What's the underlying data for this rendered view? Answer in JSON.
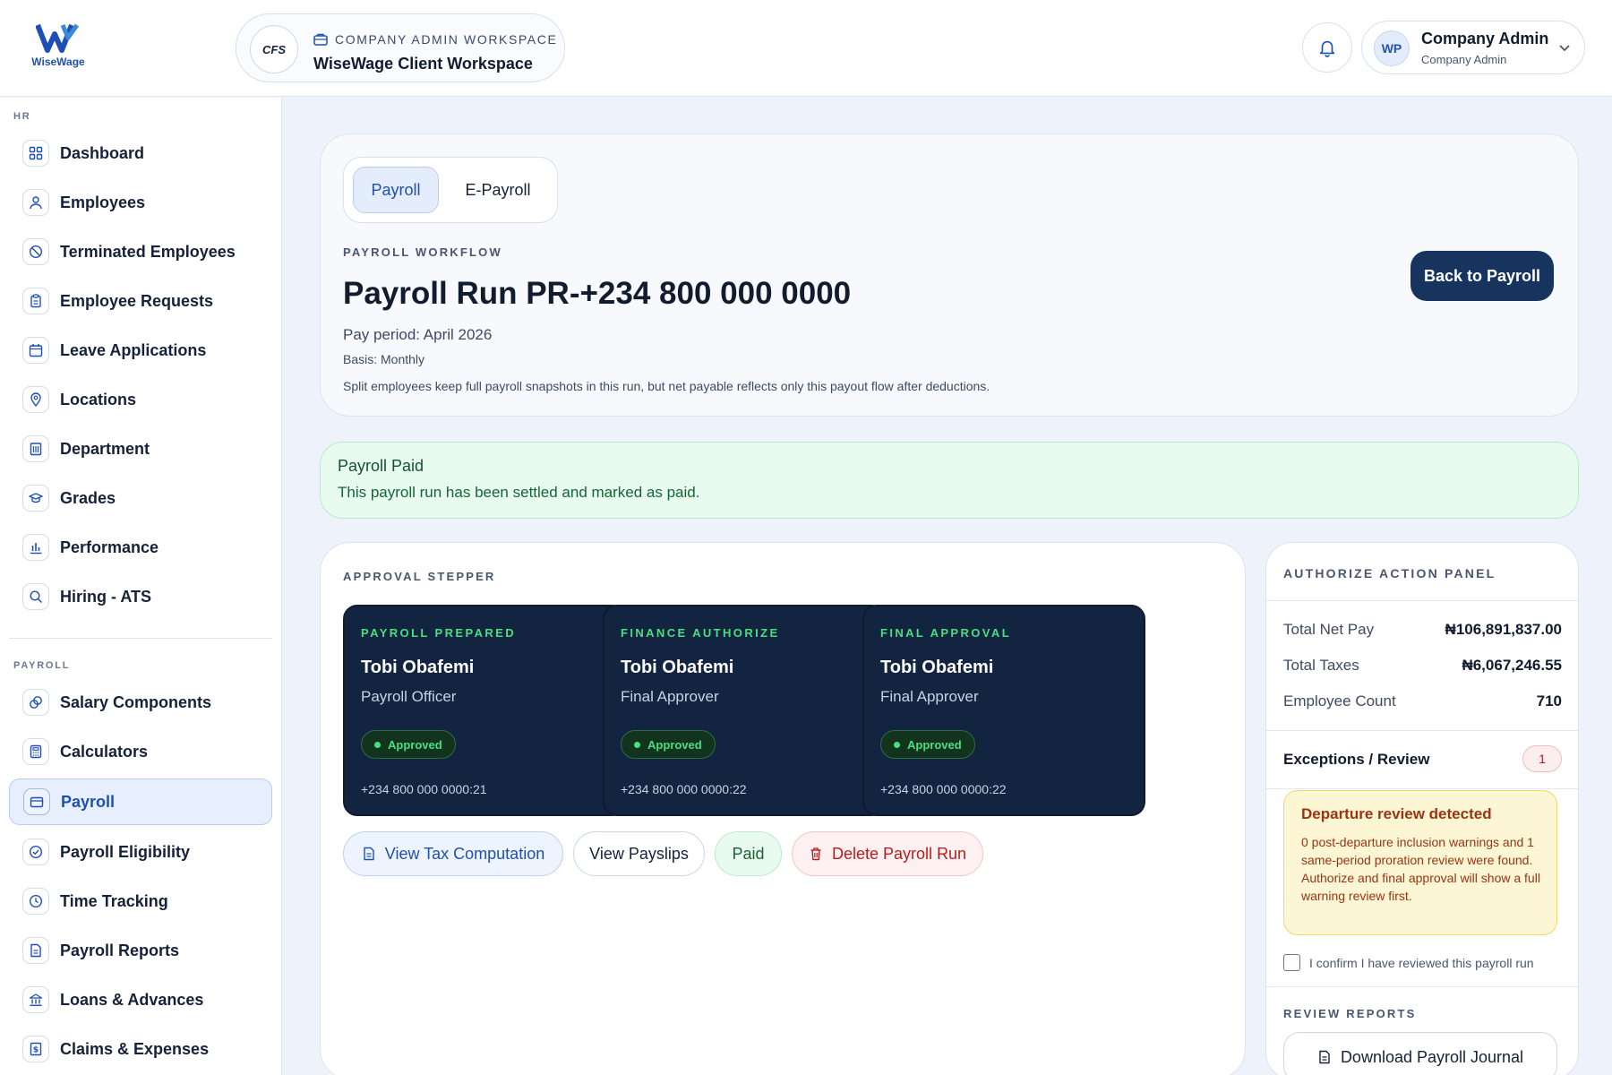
{
  "brand": {
    "name": "WiseWage"
  },
  "workspace": {
    "logo_text": "CFS",
    "eyebrow": "COMPANY ADMIN WORKSPACE",
    "name": "WiseWage Client Workspace"
  },
  "user": {
    "initials": "WP",
    "name": "Company Admin",
    "role": "Company Admin"
  },
  "sidebar": {
    "hr_label": "HR",
    "hr_items": [
      {
        "label": "Dashboard",
        "icon": "grid-icon"
      },
      {
        "label": "Employees",
        "icon": "user-icon"
      },
      {
        "label": "Terminated Employees",
        "icon": "user-off-icon"
      },
      {
        "label": "Employee Requests",
        "icon": "clipboard-icon"
      },
      {
        "label": "Leave Applications",
        "icon": "calendar-icon"
      },
      {
        "label": "Locations",
        "icon": "map-pin-icon"
      },
      {
        "label": "Department",
        "icon": "building-icon"
      },
      {
        "label": "Grades",
        "icon": "graduation-cap-icon"
      },
      {
        "label": "Performance",
        "icon": "bar-chart-icon"
      },
      {
        "label": "Hiring - ATS",
        "icon": "search-icon"
      }
    ],
    "payroll_label": "PAYROLL",
    "payroll_items": [
      {
        "label": "Salary Components",
        "icon": "coins-icon"
      },
      {
        "label": "Calculators",
        "icon": "calculator-icon"
      },
      {
        "label": "Payroll",
        "icon": "wallet-icon",
        "active": true
      },
      {
        "label": "Payroll Eligibility",
        "icon": "check-circle-icon"
      },
      {
        "label": "Time Tracking",
        "icon": "clock-icon"
      },
      {
        "label": "Payroll Reports",
        "icon": "file-text-icon"
      },
      {
        "label": "Loans & Advances",
        "icon": "bank-icon"
      },
      {
        "label": "Claims & Expenses",
        "icon": "receipt-icon"
      }
    ]
  },
  "tabs": [
    "Payroll",
    "E-Payroll"
  ],
  "header": {
    "eyebrow": "PAYROLL WORKFLOW",
    "title": "Payroll Run PR-+234 800 000 0000",
    "period": "Pay period: April 2026",
    "basis": "Basis: Monthly",
    "note": "Split employees keep full payroll snapshots in this run, but net payable reflects only this payout flow after deductions.",
    "back_label": "Back to Payroll"
  },
  "alert": {
    "title": "Payroll Paid",
    "text": "This payroll run has been settled and marked as paid."
  },
  "stepper": {
    "eyebrow": "APPROVAL STEPPER",
    "steps": [
      {
        "stage": "PAYROLL PREPARED",
        "name": "Tobi Obafemi",
        "role": "Payroll Officer",
        "status": "Approved",
        "timestamp": "+234 800 000 0000:21"
      },
      {
        "stage": "FINANCE AUTHORIZE",
        "name": "Tobi Obafemi",
        "role": "Final Approver",
        "status": "Approved",
        "timestamp": "+234 800 000 0000:22"
      },
      {
        "stage": "FINAL APPROVAL",
        "name": "Tobi Obafemi",
        "role": "Final Approver",
        "status": "Approved",
        "timestamp": "+234 800 000 0000:22"
      }
    ]
  },
  "actions": {
    "tax": "View Tax Computation",
    "payslips": "View Payslips",
    "paid": "Paid",
    "delete": "Delete Payroll Run"
  },
  "authorize": {
    "eyebrow": "AUTHORIZE ACTION PANEL",
    "stats": [
      {
        "label": "Total Net Pay",
        "value": "₦106,891,837.00"
      },
      {
        "label": "Total Taxes",
        "value": "₦6,067,246.55"
      },
      {
        "label": "Employee Count",
        "value": "710"
      }
    ],
    "exceptions_label": "Exceptions / Review",
    "exceptions_count": "1",
    "warning_title": "Departure review detected",
    "warning_text": "0 post-departure inclusion warnings and 1 same-period proration review were found. Authorize and final approval will show a full warning review first.",
    "confirm_label": "I confirm I have reviewed this payroll run",
    "reports_eyebrow": "REVIEW REPORTS",
    "download_label": "Download Payroll Journal"
  },
  "colors": {
    "accent": "#1f4fb6",
    "dark_navy": "#132440",
    "success": "#4ade80",
    "danger": "#b91c1c",
    "warning": "#9a3412"
  }
}
